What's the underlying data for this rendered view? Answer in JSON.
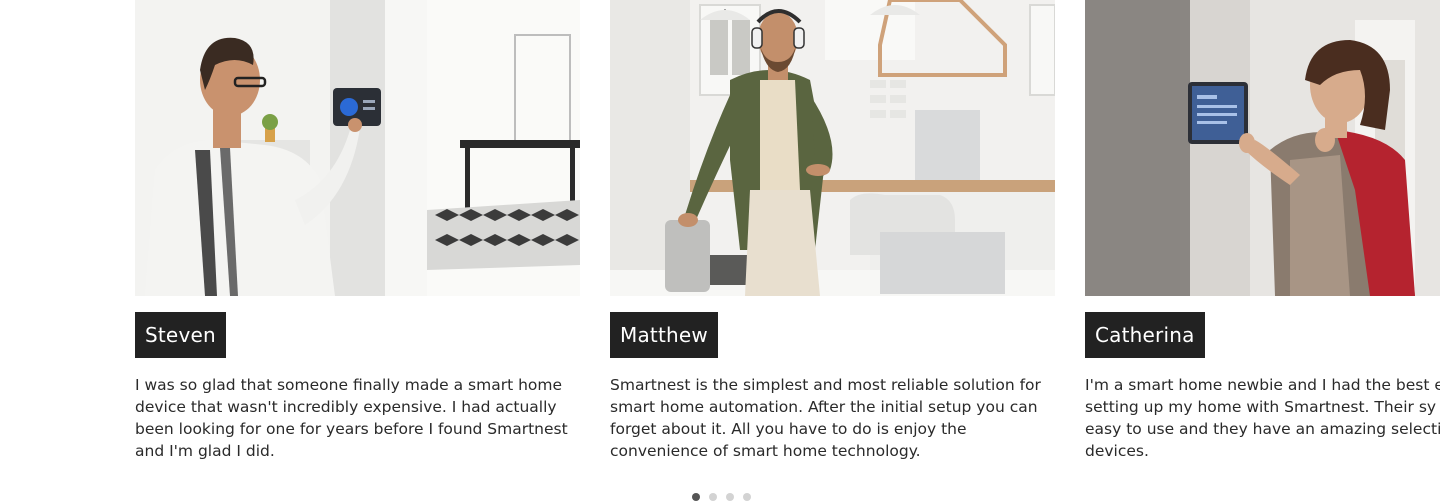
{
  "testimonials": [
    {
      "name": "Steven",
      "quote": "I was so glad that someone finally made a smart home device that wasn't incredibly expensive. I had actually been looking for one for years before I found Smartnest and I'm glad I did.",
      "photo_icon": "man-using-wall-thermostat-photo"
    },
    {
      "name": "Matthew",
      "quote": "Smartnest is the simplest and most reliable solution for smart home automation. After the initial setup you can forget about it. All you have to do is enjoy the convenience of smart home technology.",
      "photo_icon": "man-with-headphones-in-kitchen-photo"
    },
    {
      "name": "Catherina",
      "quote_lines": [
        "I'm a smart home newbie and I had the best e",
        "setting up my home with Smartnest. Their sy",
        "easy to use and they have an amazing selecti",
        "devices."
      ],
      "photo_icon": "woman-using-wall-tablet-photo"
    }
  ],
  "pagination": {
    "total": 4,
    "active": 1
  },
  "colors": {
    "name_tag_bg": "#222222",
    "dot_active": "#555555",
    "dot_inactive": "#d3d3d3"
  }
}
